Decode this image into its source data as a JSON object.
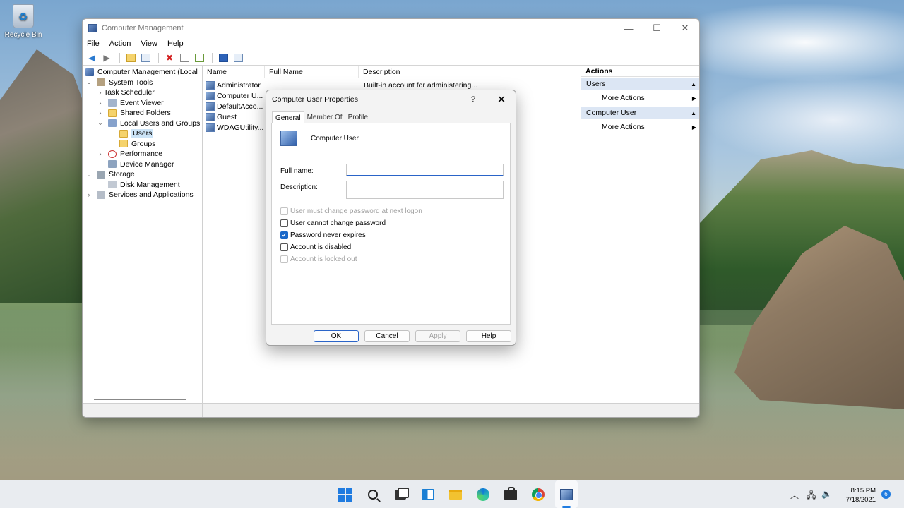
{
  "desktop": {
    "recycle_bin_label": "Recycle Bin"
  },
  "window": {
    "title": "Computer Management",
    "menu": [
      "File",
      "Action",
      "View",
      "Help"
    ],
    "controls": {
      "minimize": "—",
      "maximize": "☐",
      "close": "✕"
    }
  },
  "tree": {
    "items": [
      {
        "label": "Computer Management (Local",
        "icon": "computer-management-icon"
      },
      {
        "label": "System Tools",
        "icon": "tools-icon"
      },
      {
        "label": "Task Scheduler",
        "icon": "clock-icon"
      },
      {
        "label": "Event Viewer",
        "icon": "event-viewer-icon"
      },
      {
        "label": "Shared Folders",
        "icon": "shared-folder-icon"
      },
      {
        "label": "Local Users and Groups",
        "icon": "users-icon"
      },
      {
        "label": "Users",
        "icon": "folder-icon"
      },
      {
        "label": "Groups",
        "icon": "folder-icon"
      },
      {
        "label": "Performance",
        "icon": "performance-icon"
      },
      {
        "label": "Device Manager",
        "icon": "device-manager-icon"
      },
      {
        "label": "Storage",
        "icon": "storage-icon"
      },
      {
        "label": "Disk Management",
        "icon": "disk-icon"
      },
      {
        "label": "Services and Applications",
        "icon": "services-icon"
      }
    ]
  },
  "list": {
    "columns": [
      "Name",
      "Full Name",
      "Description"
    ],
    "rows": [
      {
        "name": "Administrator",
        "full_name": "",
        "description": "Built-in account for administering..."
      },
      {
        "name": "Computer U...",
        "full_name": "",
        "description": ""
      },
      {
        "name": "DefaultAcco...",
        "full_name": "",
        "description": ""
      },
      {
        "name": "Guest",
        "full_name": "",
        "description": ""
      },
      {
        "name": "WDAGUtility...",
        "full_name": "",
        "description": ""
      }
    ]
  },
  "actions": {
    "header": "Actions",
    "groups": [
      {
        "title": "Users",
        "item": "More Actions"
      },
      {
        "title": "Computer User",
        "item": "More Actions"
      }
    ]
  },
  "dialog": {
    "title": "Computer User Properties",
    "help": "?",
    "close": "✕",
    "tabs": [
      "General",
      "Member Of",
      "Profile"
    ],
    "user_name": "Computer User",
    "full_name_label": "Full name:",
    "full_name_value": "",
    "description_label": "Description:",
    "description_value": "",
    "checkboxes": [
      {
        "label": "User must change password at next logon",
        "checked": false,
        "enabled": false
      },
      {
        "label": "User cannot change password",
        "checked": false,
        "enabled": true
      },
      {
        "label": "Password never expires",
        "checked": true,
        "enabled": true
      },
      {
        "label": "Account is disabled",
        "checked": false,
        "enabled": true
      },
      {
        "label": "Account is locked out",
        "checked": false,
        "enabled": false
      }
    ],
    "buttons": {
      "ok": "OK",
      "cancel": "Cancel",
      "apply": "Apply",
      "help": "Help"
    }
  },
  "taskbar": {
    "time": "8:15 PM",
    "date": "7/18/2021",
    "notification_count": "6"
  }
}
